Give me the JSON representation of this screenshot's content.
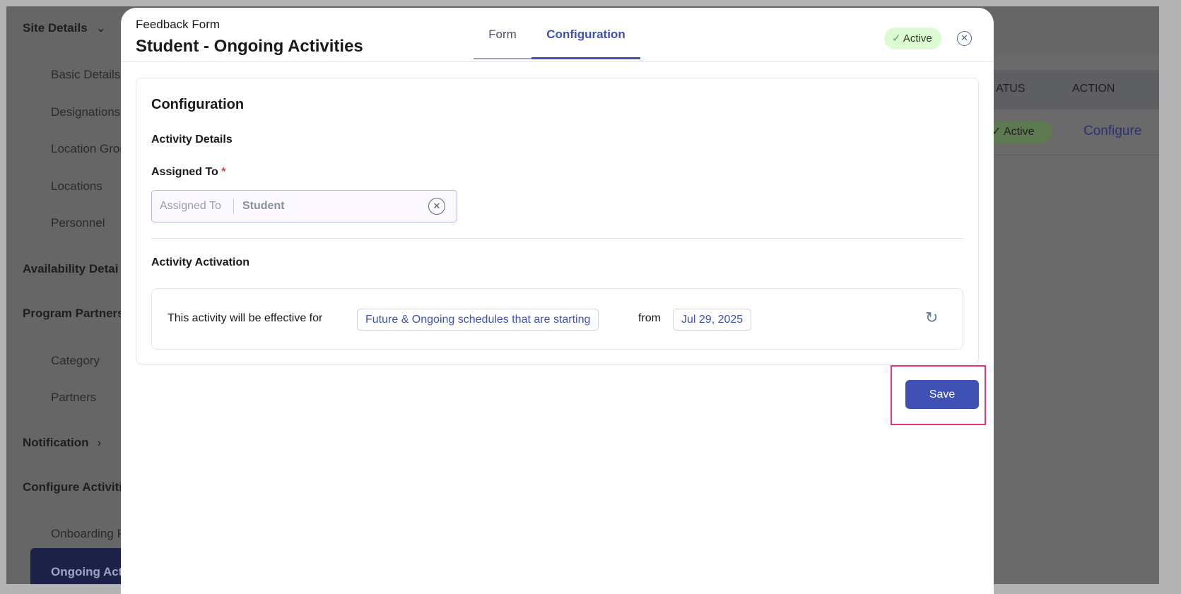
{
  "sidebar": {
    "items": [
      {
        "label": "Site Details",
        "type": "header",
        "chevron": "chevron-down"
      },
      {
        "label": "Basic Details",
        "type": "sub"
      },
      {
        "label": "Designations",
        "type": "sub"
      },
      {
        "label": "Location Grou",
        "type": "sub"
      },
      {
        "label": "Locations",
        "type": "sub"
      },
      {
        "label": "Personnel",
        "type": "sub"
      },
      {
        "label": "Availability Detai",
        "type": "header"
      },
      {
        "label": "Program Partners",
        "type": "header"
      },
      {
        "label": "Category",
        "type": "sub"
      },
      {
        "label": "Partners",
        "type": "sub"
      },
      {
        "label": "Notification",
        "type": "header",
        "chevron": "chevron-right"
      },
      {
        "label": "Configure Activiti",
        "type": "header"
      },
      {
        "label": "Onboarding R",
        "type": "sub"
      },
      {
        "label": "Ongoing Activ",
        "type": "sub",
        "active": true
      }
    ]
  },
  "background_table": {
    "columns": [
      "ATUS",
      "ACTION"
    ],
    "row": {
      "status": "Active",
      "action": "Configure"
    }
  },
  "modal": {
    "subtitle": "Feedback Form",
    "title": "Student - Ongoing Activities",
    "tabs": [
      {
        "label": "Form",
        "active": false
      },
      {
        "label": "Configuration",
        "active": true
      }
    ],
    "status_badge": "Active",
    "config": {
      "heading": "Configuration",
      "activity_details": "Activity Details",
      "assigned_label": "Assigned To",
      "required_mark": "*",
      "assigned_prefix": "Assigned To",
      "assigned_value": "Student",
      "activation_heading": "Activity Activation",
      "effective_text": "This activity will be effective for",
      "schedule_option": "Future & Ongoing schedules that are starting",
      "from_text": "from",
      "date": "Jul 29, 2025"
    },
    "save_label": "Save"
  },
  "colors": {
    "accent": "#3f51b5",
    "active_bg": "#ddfbd3",
    "highlight": "#e8336d",
    "overlay": "#666666"
  }
}
